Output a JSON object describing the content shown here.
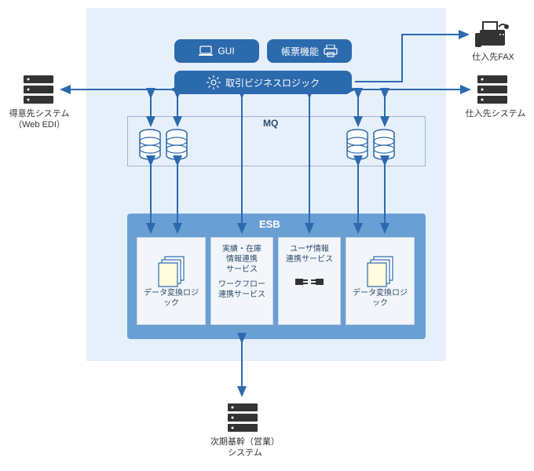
{
  "pills": {
    "gui": "GUI",
    "report": "帳票機能",
    "logic": "取引ビジネスロジック"
  },
  "mq": {
    "label": "MQ"
  },
  "esb": {
    "label": "ESB",
    "card_left": "データ変換ロジック",
    "card_mid1_line1": "実績・在庫",
    "card_mid1_line2": "情報連携",
    "card_mid1_line3": "サービス",
    "card_mid1_line4": "ワークフロー",
    "card_mid1_line5": "連携サービス",
    "card_mid2_line1": "ユーザ情報",
    "card_mid2_line2": "連携サービス",
    "card_right": "データ変換ロジック"
  },
  "external": {
    "customer_line1": "得意先システム",
    "customer_line2": "（Web EDI）",
    "supplier_fax": "仕入先FAX",
    "supplier_sys": "仕入先システム",
    "next_gen_line1": "次期基幹（営業）",
    "next_gen_line2": "システム"
  },
  "colors": {
    "accent": "#2c6aae",
    "arrow": "#2c6aae",
    "bg": "#e6f0fa",
    "esb": "#6a9fd4"
  }
}
